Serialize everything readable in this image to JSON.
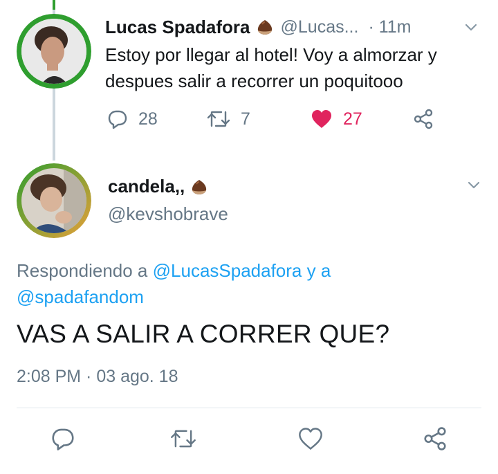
{
  "parent_tweet": {
    "name": "Lucas Spadafora",
    "handle": "@Lucas...",
    "time": "· 11m",
    "text": "Estoy por llegar al hotel! Voy a almorzar y despues salir a recorrer un poquitooo",
    "actions": {
      "reply_count": "28",
      "retweet_count": "7",
      "like_count": "27"
    },
    "liked": true
  },
  "reply_tweet": {
    "name": "candela,,",
    "handle": "@kevshobrave",
    "replying_prefix": "Respondiendo a",
    "replying_mention_1": "@LucasSpadafora",
    "replying_and": "y a",
    "replying_mention_2": "@spadafandom",
    "text": "VAS A SALIR A CORRER QUE?",
    "timestamp": "2:08 PM · 03 ago. 18"
  },
  "colors": {
    "text": "#14171a",
    "secondary": "#657786",
    "link": "#1da1f2",
    "like": "#e0245e",
    "parent_avatar_ring": "#2f9e2f",
    "reply_avatar_ring": "#e8a13a"
  },
  "icons": [
    "chestnut-emoji",
    "chevron-down-icon",
    "reply-icon",
    "retweet-icon",
    "heart-icon",
    "share-icon"
  ]
}
